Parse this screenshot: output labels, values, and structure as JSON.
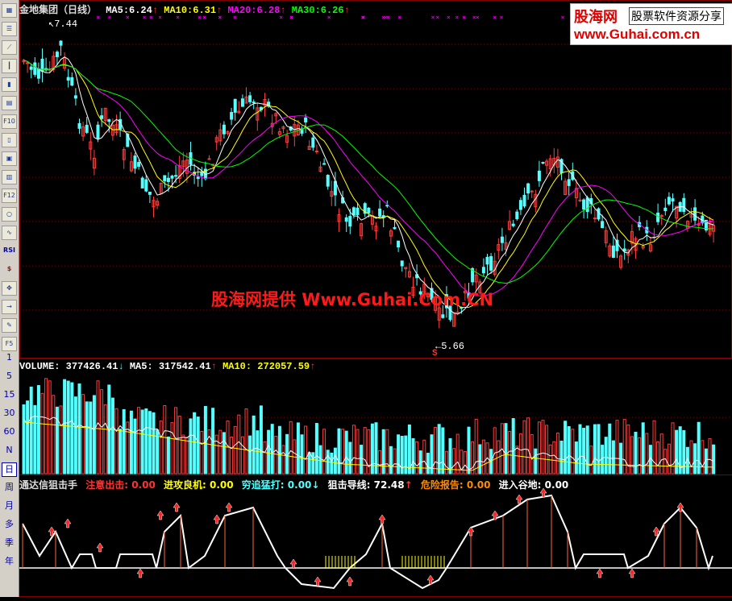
{
  "toolbar": {
    "icons": [
      "chart-icon",
      "list-icon",
      "line-chart-icon",
      "candle-icon",
      "bar-chart-icon",
      "table-icon",
      "f10-icon",
      "doc-icon",
      "note-icon",
      "calc-icon",
      "f12-icon",
      "search-icon",
      "wave-icon",
      "rsi-icon",
      "dollar-icon",
      "move-icon",
      "exit-icon",
      "pencil-icon",
      "f5-icon"
    ],
    "f10_label": "F10",
    "f12_label": "F12",
    "rsi_label": "RSI",
    "dollar_label": "$",
    "f5_label": "F5",
    "periods": [
      "1",
      "5",
      "15",
      "30",
      "60",
      "N",
      "日",
      "周",
      "月",
      "多",
      "季",
      "年"
    ]
  },
  "main": {
    "stock": "金地集团（日线）",
    "ma5_label": "MA5:",
    "ma5": "6.24",
    "ma10_label": "MA10:",
    "ma10": "6.31",
    "ma20_label": "MA20:",
    "ma20": "6.28",
    "ma30_label": "MA30:",
    "ma30": "6.26",
    "high_label": "7.44",
    "low_label": "5.66",
    "signal_mark": "S"
  },
  "volume": {
    "label": "VOLUME:",
    "value": "377426.41",
    "ma5_label": "MA5:",
    "ma5": "317542.41",
    "ma10_label": "MA10:",
    "ma10": "272057.59"
  },
  "indicator": {
    "name": "通达信狙击手",
    "attention_label": "注意出击:",
    "attention": "0.00",
    "attack_label": "进攻良机:",
    "attack": "0.00",
    "chase_label": "穷追猛打:",
    "chase": "0.00",
    "guide_label": "狙击导线:",
    "guide": "72.48",
    "danger_label": "危险报告:",
    "danger": "0.00",
    "valley_label": "进入谷地:",
    "valley": "0.00"
  },
  "watermark": "股海网提供 Www.Guhai.Com.CN",
  "logo": {
    "brand": "股海网",
    "slogan": "股票软件资源分享",
    "url": "www.Guhai.com.cn"
  },
  "colors": {
    "up": "#ff3c3c",
    "down": "#54ffff",
    "ma5": "#ffffff",
    "ma10": "#ffff00",
    "ma20": "#ff00ff",
    "ma30": "#00ff00",
    "grid": "#800000"
  }
}
